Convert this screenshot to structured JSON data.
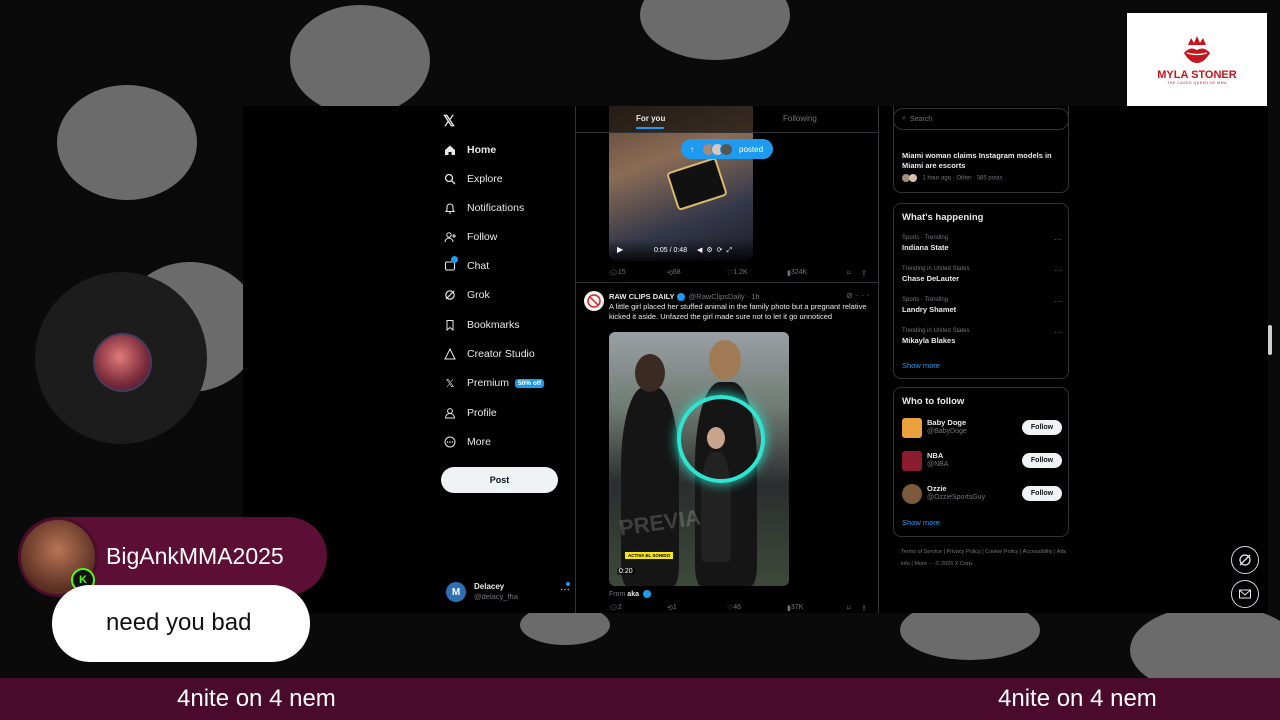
{
  "nav": {
    "items": [
      {
        "label": "Home",
        "icon": "home-icon"
      },
      {
        "label": "Explore",
        "icon": "search-icon"
      },
      {
        "label": "Notifications",
        "icon": "bell-icon"
      },
      {
        "label": "Follow",
        "icon": "follow-icon"
      },
      {
        "label": "Chat",
        "icon": "chat-icon"
      },
      {
        "label": "Grok",
        "icon": "grok-icon"
      },
      {
        "label": "Bookmarks",
        "icon": "bookmark-icon"
      },
      {
        "label": "Creator Studio",
        "icon": "creator-studio-icon"
      },
      {
        "label": "Premium",
        "icon": "x-premium-icon",
        "badge": "50% off"
      },
      {
        "label": "Profile",
        "icon": "person-icon"
      },
      {
        "label": "More",
        "icon": "more-circle-icon"
      }
    ],
    "post_label": "Post",
    "account": {
      "initial": "M",
      "name": "Delacey",
      "handle": "@delacy_fha"
    }
  },
  "feed": {
    "tabs": {
      "for_you": "For you",
      "following": "Following"
    },
    "new_posts_label": "posted",
    "post1": {
      "video_time": "0:05 / 0:48",
      "replies": "15",
      "reposts": "68",
      "likes": "1.2K",
      "views": "324K"
    },
    "post2": {
      "name": "RAW CLIPS DAILY",
      "handle": "@RawClipsDaily",
      "age": "· 1h",
      "text": "A little girl placed her stuffed animal in the family photo but a pregnant relative kicked it aside. Unfazed the girl made sure not to let it go unnoticed",
      "watermark": "PREVIA",
      "tag": "ACTIVA EL SONIDO",
      "video_time": "0:20",
      "from_prefix": "From",
      "from_name": "aka",
      "replies": "2",
      "reposts": "1",
      "likes": "46",
      "views": "37K"
    }
  },
  "right": {
    "search_placeholder": "Search",
    "news": {
      "headline": "Miami woman claims Instagram models in Miami are escorts",
      "meta": "1 hour ago · Other · 385 posts"
    },
    "happening": {
      "title": "What's happening",
      "trends": [
        {
          "category": "Sports · Trending",
          "name": "Indiana State"
        },
        {
          "category": "Trending in United States",
          "name": "Chase DeLauter"
        },
        {
          "category": "Sports · Trending",
          "name": "Landry Shamet"
        },
        {
          "category": "Trending in United States",
          "name": "Mikayla Blakes"
        }
      ],
      "show_more": "Show more"
    },
    "who_to_follow": {
      "title": "Who to follow",
      "accounts": [
        {
          "name": "Baby Doge",
          "handle": "@BabyDoge",
          "color": "#e9a23b"
        },
        {
          "name": "NBA",
          "handle": "@NBA",
          "color": "#8a1d2d"
        },
        {
          "name": "Ozzie",
          "handle": "@OzzieSportsGuy",
          "color": "#7a5a3a"
        }
      ],
      "follow_label": "Follow",
      "show_more": "Show more"
    },
    "footer": "Terms of Service | Privacy Policy | Cookie Policy | Accessibility | Ads info | More ··· © 2026 X Corp."
  },
  "overlay": {
    "logo": {
      "title": "MYLA STONER",
      "subtitle": "THE CAGED QUEEN OF MMA"
    },
    "chat": {
      "username": "BigAnkMMA2025",
      "message": "need you bad"
    },
    "ticker_left": "4nite on 4 nem",
    "ticker_right": "4nite on 4 nem"
  }
}
